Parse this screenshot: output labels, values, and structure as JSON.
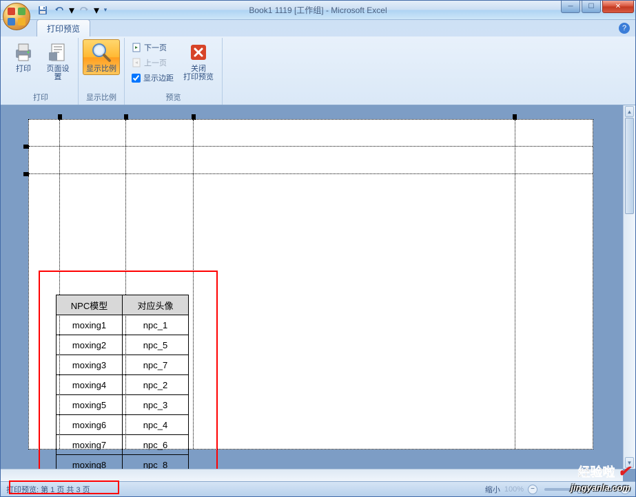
{
  "window": {
    "title": "Book1 1119  [工作组] - Microsoft Excel"
  },
  "qat": {
    "save": "💾",
    "undo": "↶",
    "redo": "↷"
  },
  "tabs": {
    "print_preview": "打印预览"
  },
  "ribbon": {
    "print_group": {
      "label": "打印",
      "print_btn": "打印",
      "page_setup_btn": "页面设置"
    },
    "zoom_group": {
      "label": "显示比例",
      "zoom_btn": "显示比例"
    },
    "preview_group": {
      "label": "预览",
      "next_page": "下一页",
      "prev_page": "上一页",
      "show_margins": "显示边距",
      "close_btn_line1": "关闭",
      "close_btn_line2": "打印预览"
    }
  },
  "table": {
    "headers": [
      "NPC模型",
      "对应头像"
    ],
    "rows": [
      [
        "moxing1",
        "npc_1"
      ],
      [
        "moxing2",
        "npc_5"
      ],
      [
        "moxing3",
        "npc_7"
      ],
      [
        "moxing4",
        "npc_2"
      ],
      [
        "moxing5",
        "npc_3"
      ],
      [
        "moxing6",
        "npc_4"
      ],
      [
        "moxing7",
        "npc_6"
      ],
      [
        "moxing8",
        "npc_8"
      ]
    ]
  },
  "statusbar": {
    "preview_status": "打印预览: 第 1 页 共 3 页",
    "zoom_label": "缩小",
    "zoom_value": "100%"
  },
  "watermark": {
    "brand": "经验啦",
    "url": "jingyanla.com"
  }
}
